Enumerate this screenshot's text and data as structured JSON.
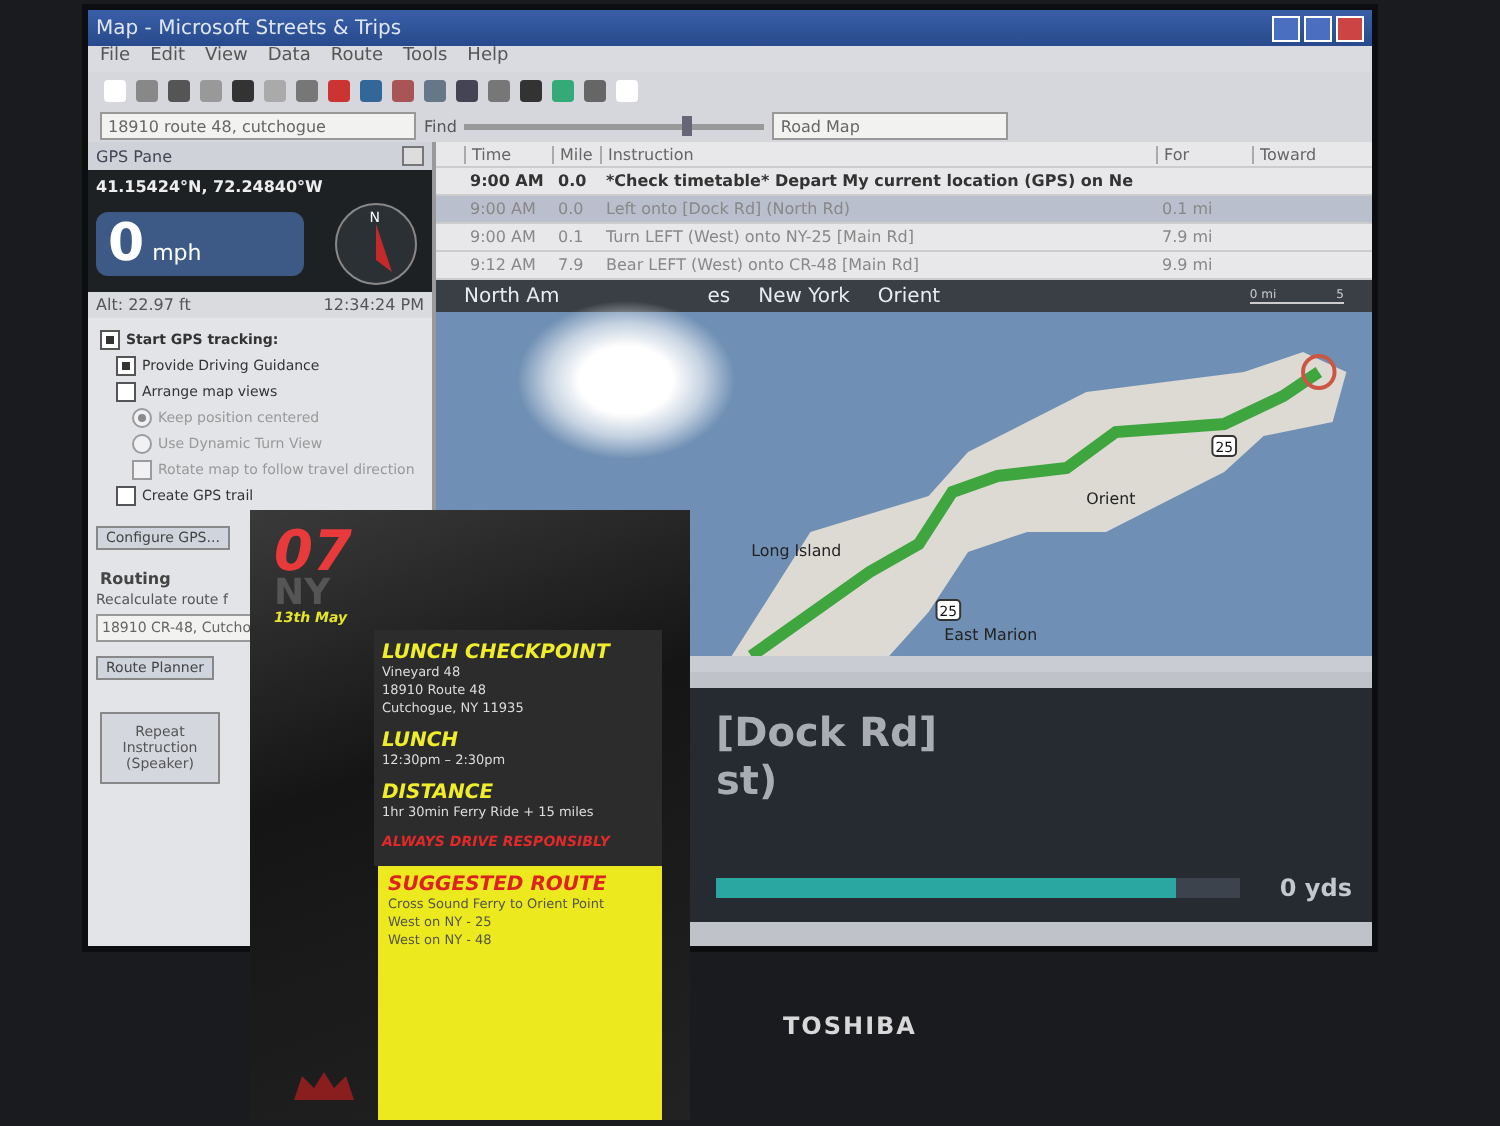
{
  "window": {
    "title": "Map - Microsoft Streets & Trips"
  },
  "menu": [
    "File",
    "Edit",
    "View",
    "Data",
    "Route",
    "Tools",
    "Help"
  ],
  "toolbar": {
    "address": "18910 route 48, cutchogue",
    "find_label": "Find",
    "zoom_slider": {
      "level": 0.75
    },
    "map_style": "Road Map"
  },
  "gps_pane": {
    "title": "GPS Pane",
    "coordinates": "41.15424°N, 72.24840°W",
    "speed": "0",
    "speed_unit": "mph",
    "compass_label": "N",
    "altitude": "Alt: 22.97 ft",
    "time": "12:34:24 PM",
    "options": [
      {
        "kind": "checkbox",
        "label": "Start GPS tracking:",
        "checked": true,
        "disabled": false,
        "children": [
          {
            "kind": "checkbox",
            "label": "Provide Driving Guidance",
            "checked": true,
            "disabled": false
          },
          {
            "kind": "checkbox",
            "label": "Arrange map views",
            "checked": false,
            "disabled": false,
            "children": [
              {
                "kind": "radio",
                "label": "Keep position centered",
                "selected": true,
                "disabled": true
              },
              {
                "kind": "radio",
                "label": "Use Dynamic Turn View",
                "selected": false,
                "disabled": true
              },
              {
                "kind": "checkbox",
                "label": "Rotate map to follow travel direction",
                "checked": false,
                "disabled": true
              }
            ]
          },
          {
            "kind": "checkbox",
            "label": "Create GPS trail",
            "checked": false,
            "disabled": false
          }
        ]
      }
    ],
    "configure_button": "Configure GPS..."
  },
  "routing": {
    "heading": "Routing",
    "recalculate_label": "Recalculate route f",
    "route_value": "18910 CR-48, Cutcho",
    "planner_button": "Route Planner",
    "repeat_button": "Repeat Instruction (Speaker)"
  },
  "directions": {
    "columns": [
      "Time",
      "Mile",
      "Instruction",
      "For",
      "Toward"
    ],
    "rows": [
      {
        "time": "9:00 AM",
        "mile": "0.0",
        "instruction": "*Check timetable* Depart My current location (GPS) on Ne",
        "for": "",
        "selected": false
      },
      {
        "time": "9:00 AM",
        "mile": "0.0",
        "instruction": "Left onto [Dock Rd] (North Rd)",
        "for": "0.1 mi",
        "selected": true
      },
      {
        "time": "9:00 AM",
        "mile": "0.1",
        "instruction": "Turn LEFT (West) onto NY-25 [Main Rd]",
        "for": "7.9 mi",
        "selected": false
      },
      {
        "time": "9:12 AM",
        "mile": "7.9",
        "instruction": "Bear LEFT (West) onto CR-48 [Main Rd]",
        "for": "9.9 mi",
        "selected": false
      }
    ]
  },
  "map": {
    "breadcrumbs": [
      "North Am",
      "es",
      "New York",
      "Orient"
    ],
    "scale": [
      "0 mi",
      "5"
    ],
    "labels": [
      {
        "kind": "shield",
        "text": "25"
      },
      {
        "kind": "place",
        "text": "Orient"
      },
      {
        "kind": "place",
        "text": "Long Island"
      },
      {
        "kind": "shield",
        "text": "25"
      },
      {
        "kind": "place",
        "text": "East Marion"
      }
    ]
  },
  "guidance": {
    "lines": [
      "[Dock Rd]",
      "st)"
    ],
    "distance": "0 yds",
    "level": 0.88
  },
  "laptop": {
    "brand": "TOSHIBA"
  },
  "card": {
    "number": "07",
    "state": "NY",
    "date": "13th May",
    "sections": [
      {
        "kind": "block",
        "heading": "LUNCH CHECKPOINT",
        "lines": [
          "Vineyard 48",
          "18910 Route 48",
          "Cutchogue, NY 11935"
        ]
      },
      {
        "kind": "block",
        "heading": "LUNCH",
        "lines": [
          "12:30pm – 2:30pm"
        ]
      },
      {
        "kind": "block",
        "heading": "DISTANCE",
        "lines": [
          "1hr 30min Ferry Ride + 15 miles"
        ]
      },
      {
        "kind": "warning",
        "heading": "ALWAYS DRIVE RESPONSIBLY"
      }
    ],
    "route": {
      "heading": "SUGGESTED ROUTE",
      "lines": [
        "Cross Sound Ferry to Orient Point",
        "West on NY - 25",
        "West on NY - 48"
      ]
    }
  }
}
